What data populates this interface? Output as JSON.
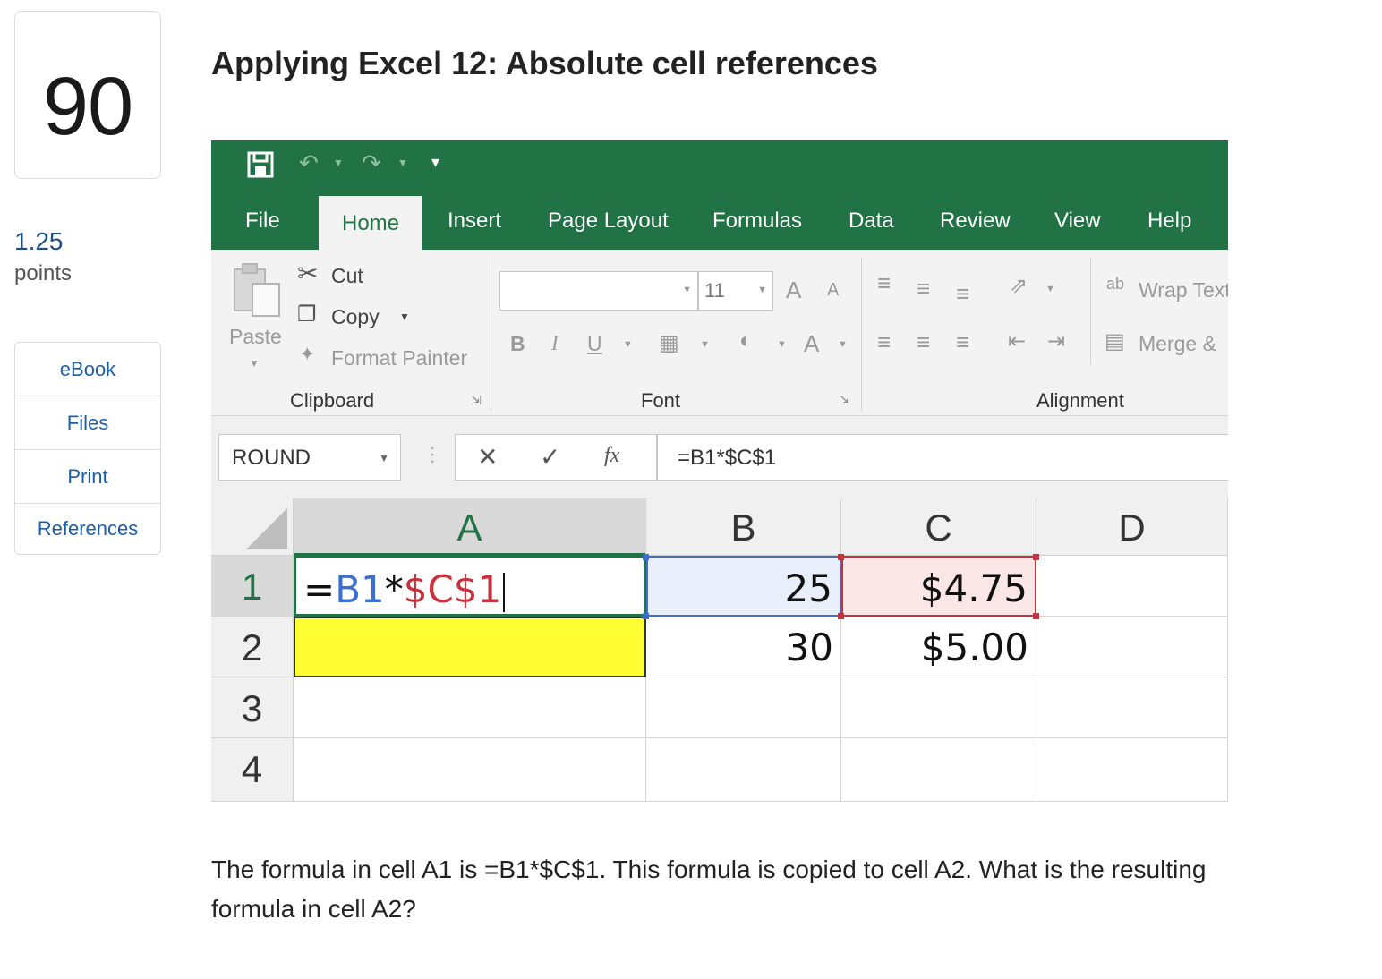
{
  "sidebar": {
    "question_number": "90",
    "points_value": "1.25",
    "points_label": "points",
    "links": [
      "eBook",
      "Files",
      "Print",
      "References"
    ]
  },
  "title": "Applying Excel 12: Absolute cell references",
  "excel": {
    "tabs": [
      "File",
      "Home",
      "Insert",
      "Page Layout",
      "Formulas",
      "Data",
      "Review",
      "View",
      "Help"
    ],
    "active_tab": "Home",
    "clipboard": {
      "paste": "Paste",
      "cut": "Cut",
      "copy": "Copy",
      "format_painter": "Format Painter",
      "group_label": "Clipboard"
    },
    "font": {
      "size": "11",
      "bold": "B",
      "italic": "I",
      "underline": "U",
      "font_color": "A",
      "grow": "A",
      "shrink": "A",
      "group_label": "Font"
    },
    "alignment": {
      "wrap_text": "Wrap Text",
      "merge": "Merge &",
      "group_label": "Alignment"
    },
    "name_box": "ROUND",
    "formula_bar": "=B1*$C$1",
    "fx": "fx",
    "columns": [
      "A",
      "B",
      "C",
      "D"
    ],
    "rows": [
      "1",
      "2",
      "3",
      "4"
    ],
    "cells": {
      "A1": {
        "part1": "=",
        "part2": "B1",
        "part3": "*",
        "part4": "$C$1"
      },
      "B1": "25",
      "C1": "$4.75",
      "B2": "30",
      "C2": "$5.00"
    },
    "colors": {
      "excel_green": "#217346",
      "ref_blue": "#3b6fd1",
      "ref_red": "#c8323c",
      "highlight_yellow": "#ffff33"
    }
  },
  "question_text": "The formula in cell A1 is =B1*$C$1.  This formula is copied to cell A2.  What is the resulting formula in cell A2?"
}
